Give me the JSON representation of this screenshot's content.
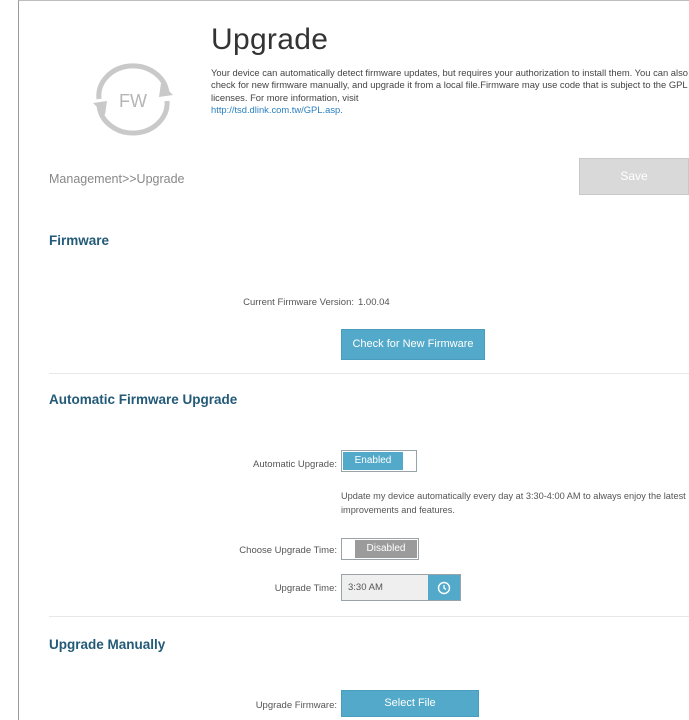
{
  "header": {
    "logo_text": "FW",
    "title": "Upgrade",
    "description": "Your device can automatically detect firmware updates, but requires your authorization to install them. You can also check for new firmware manually, and upgrade it from a local file.Firmware may use code that is subject to the GPL licenses. For more information, visit",
    "gpl_link": "http://tsd.dlink.com.tw/GPL.asp."
  },
  "breadcrumb": "Management>>Upgrade",
  "toolbar": {
    "save_label": "Save"
  },
  "firmware": {
    "title": "Firmware",
    "current_version_label": "Current Firmware Version:",
    "current_version_value": "1.00.04",
    "check_button": "Check for New Firmware"
  },
  "auto_upgrade": {
    "title": "Automatic Firmware Upgrade",
    "automatic_label": "Automatic Upgrade:",
    "automatic_state": "Enabled",
    "hint": "Update my device automatically every day at 3:30-4:00 AM to always enjoy the latest improvements and features.",
    "choose_time_label": "Choose Upgrade Time:",
    "choose_time_state": "Disabled",
    "upgrade_time_label": "Upgrade Time:",
    "upgrade_time_value": "3:30 AM"
  },
  "manual": {
    "title": "Upgrade Manually",
    "upgrade_firmware_label": "Upgrade Firmware:",
    "select_file_button": "Select File"
  },
  "colors": {
    "accent": "#53a9c9",
    "section_title": "#235a78",
    "disabled_toggle": "#9b9b9b",
    "save_disabled": "#d9d9d9"
  },
  "icons": [
    "fw-cycle-icon",
    "clock-icon"
  ]
}
